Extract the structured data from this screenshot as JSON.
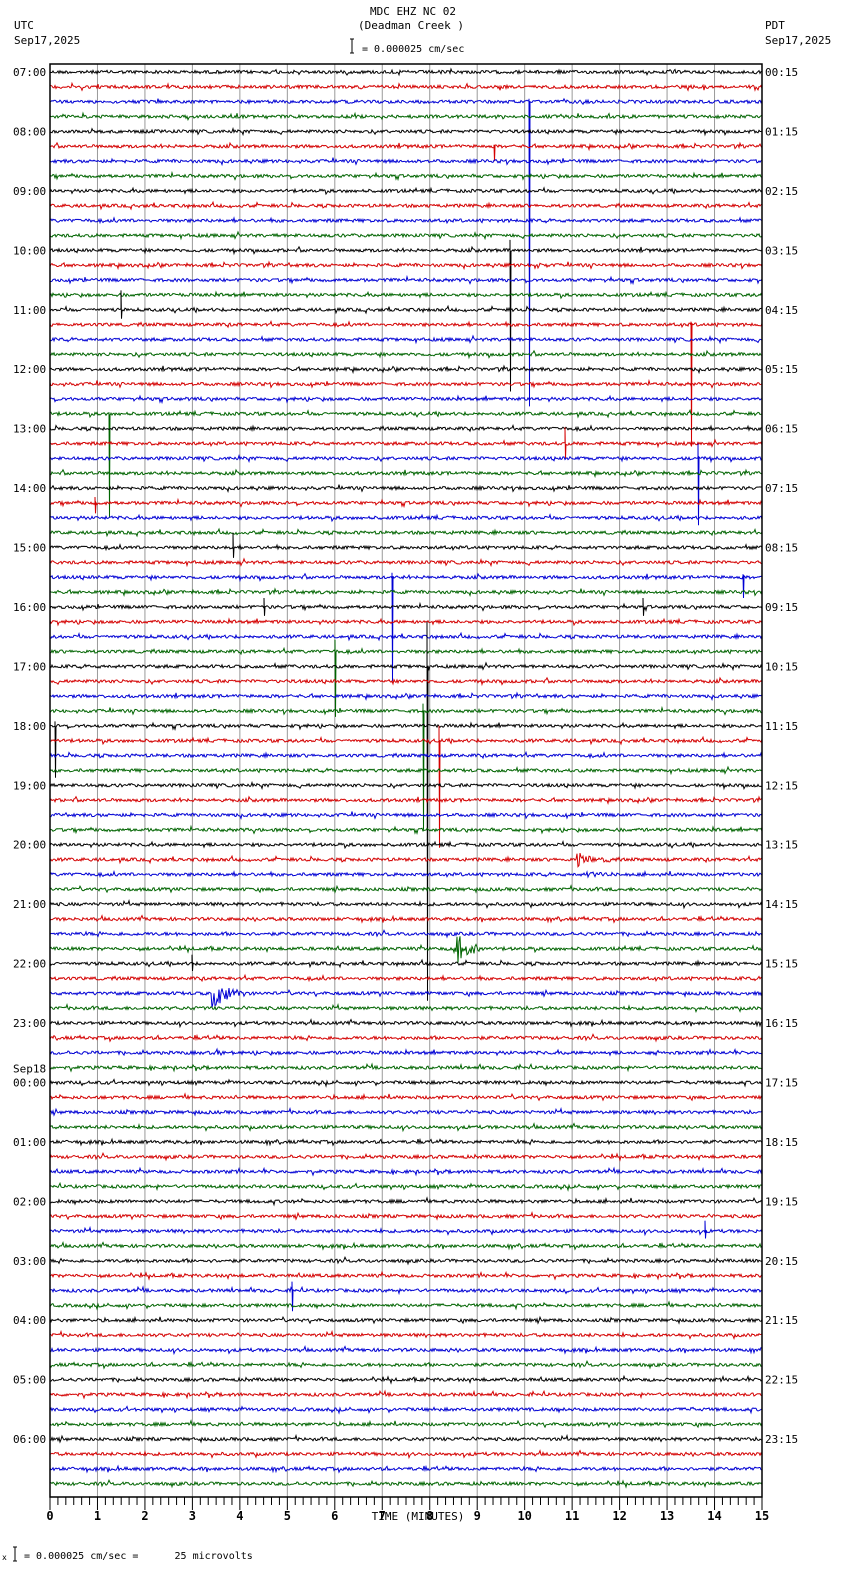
{
  "chart_data": {
    "type": "line",
    "title": "MDC EHZ NC 02",
    "subtitle": "(Deadman Creek )",
    "scale_label": "= 0.000025 cm/sec",
    "left_tz": "UTC",
    "left_date": "Sep17,2025",
    "right_tz": "PDT",
    "right_date": "Sep17,2025",
    "date_change_label": "Sep18",
    "xlabel": "TIME (MINUTES)",
    "xlim": [
      0,
      15
    ],
    "x_ticks": [
      "0",
      "1",
      "2",
      "3",
      "4",
      "5",
      "6",
      "7",
      "8",
      "9",
      "10",
      "11",
      "12",
      "13",
      "14",
      "15"
    ],
    "traces_per_hour": 4,
    "trace_colors": [
      "#000000",
      "#d40000",
      "#0000d4",
      "#006400"
    ],
    "left_hour_labels": [
      "07:00",
      "08:00",
      "09:00",
      "10:00",
      "11:00",
      "12:00",
      "13:00",
      "14:00",
      "15:00",
      "16:00",
      "17:00",
      "18:00",
      "19:00",
      "20:00",
      "21:00",
      "22:00",
      "23:00",
      "00:00",
      "01:00",
      "02:00",
      "03:00",
      "04:00",
      "05:00",
      "06:00"
    ],
    "right_hour_labels": [
      "00:15",
      "01:15",
      "02:15",
      "03:15",
      "04:15",
      "05:15",
      "06:15",
      "07:15",
      "08:15",
      "09:15",
      "10:15",
      "11:15",
      "12:15",
      "13:15",
      "14:15",
      "15:15",
      "16:15",
      "17:15",
      "18:15",
      "19:15",
      "20:15",
      "21:15",
      "22:15",
      "23:15"
    ],
    "events": [
      {
        "row": 2,
        "minute": 10.1,
        "up": 0.2,
        "down": 20.5,
        "type": "spike"
      },
      {
        "row": 12,
        "minute": 9.7,
        "up": 0.7,
        "down": 9.5,
        "type": "spike"
      },
      {
        "row": 16,
        "minute": 1.5,
        "up": 1.3,
        "down": 0.6,
        "type": "spike"
      },
      {
        "row": 5,
        "minute": 9.35,
        "up": 0.1,
        "down": 1.0,
        "type": "spike"
      },
      {
        "row": 17,
        "minute": 13.5,
        "up": 0.2,
        "down": 8.2,
        "type": "spike"
      },
      {
        "row": 25,
        "minute": 10.85,
        "up": 1.1,
        "down": 1.0,
        "type": "spike"
      },
      {
        "row": 23,
        "minute": 1.25,
        "up": 0.1,
        "down": 7.0,
        "type": "spike"
      },
      {
        "row": 26,
        "minute": 13.65,
        "up": 1.0,
        "down": 4.5,
        "type": "spike"
      },
      {
        "row": 32,
        "minute": 3.85,
        "up": 1.0,
        "down": 0.7,
        "type": "spike"
      },
      {
        "row": 34,
        "minute": 14.6,
        "up": 0.2,
        "down": 1.4,
        "type": "spike"
      },
      {
        "row": 34,
        "minute": 7.2,
        "up": 0.3,
        "down": 7.0,
        "type": "spike"
      },
      {
        "row": 36,
        "minute": 4.5,
        "up": 0.6,
        "down": 0.6,
        "type": "spike"
      },
      {
        "row": 36,
        "minute": 12.5,
        "up": 0.6,
        "down": 0.6,
        "type": "spike"
      },
      {
        "row": 39,
        "minute": 6.0,
        "up": 0.8,
        "down": 4.4,
        "type": "spike"
      },
      {
        "row": 40,
        "minute": 7.95,
        "up": 3.0,
        "down": 22.5,
        "type": "spike"
      },
      {
        "row": 43,
        "minute": 7.85,
        "up": 0.5,
        "down": 8.0,
        "type": "spike"
      },
      {
        "row": 44,
        "minute": 0.1,
        "up": 0.3,
        "down": 3.5,
        "type": "spike"
      },
      {
        "row": 45,
        "minute": 8.2,
        "up": 1.0,
        "down": 7.2,
        "type": "spike"
      },
      {
        "row": 53,
        "minute": 11.1,
        "dur": 0.8,
        "amp": 0.5,
        "type": "burst"
      },
      {
        "row": 54,
        "minute": 11.3,
        "dur": 0.7,
        "amp": 0.3,
        "type": "burst"
      },
      {
        "row": 59,
        "minute": 8.5,
        "dur": 0.7,
        "amp": 1.3,
        "type": "burst"
      },
      {
        "row": 62,
        "minute": 3.4,
        "dur": 0.7,
        "amp": 1.4,
        "type": "burst"
      },
      {
        "row": 60,
        "minute": 3.0,
        "up": 0.6,
        "down": 0.5,
        "type": "spike"
      },
      {
        "row": 66,
        "minute": 3.5,
        "dur": 0.4,
        "amp": 0.3,
        "type": "burst"
      },
      {
        "row": 66,
        "minute": 12.6,
        "dur": 0.4,
        "amp": 0.3,
        "type": "burst"
      },
      {
        "row": 78,
        "minute": 13.8,
        "up": 0.7,
        "down": 0.5,
        "type": "spike"
      },
      {
        "row": 82,
        "minute": 5.1,
        "up": 0.6,
        "down": 1.4,
        "type": "spike"
      },
      {
        "row": 90,
        "minute": 13.4,
        "dur": 0.3,
        "amp": 0.4,
        "type": "burst"
      },
      {
        "row": 29,
        "minute": 0.95,
        "up": 0.4,
        "down": 0.7,
        "type": "spike"
      },
      {
        "row": 13,
        "minute": 10.2,
        "up": 0.3,
        "down": 0.3,
        "type": "burst_small"
      }
    ]
  },
  "footer": {
    "scale_text": "= 0.000025 cm/sec =      25 microvolts",
    "mark": "x"
  }
}
